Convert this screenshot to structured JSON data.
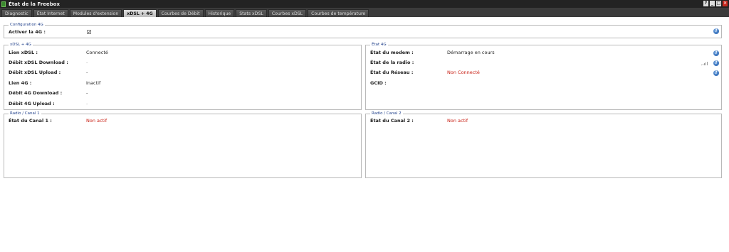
{
  "window": {
    "title": "État de la Freebox",
    "buttons": [
      "?",
      "_",
      "□",
      "✕"
    ]
  },
  "tabs": [
    {
      "label": "Diagnostic",
      "active": false
    },
    {
      "label": "État Internet",
      "active": false
    },
    {
      "label": "Modules d'extension",
      "active": false
    },
    {
      "label": "xDSL + 4G",
      "active": true
    },
    {
      "label": "Courbes de Débit",
      "active": false
    },
    {
      "label": "Historique",
      "active": false
    },
    {
      "label": "Stats xDSL",
      "active": false
    },
    {
      "label": "Courbes xDSL",
      "active": false
    },
    {
      "label": "Courbes de température",
      "active": false
    }
  ],
  "config4g": {
    "legend": "Configuration 4G",
    "activer_label": "Activer la 4G :",
    "activer_checked": true,
    "checkmark": "✓"
  },
  "xdsl4g": {
    "legend": "xDSL + 4G",
    "rows": [
      {
        "label": "Lien xDSL :",
        "value": "Connecté",
        "style": "normal"
      },
      {
        "label": "Débit xDSL Download :",
        "value": "-",
        "style": "muted"
      },
      {
        "label": "Débit xDSL Upload :",
        "value": "-",
        "style": "normal"
      },
      {
        "label": "Lien 4G :",
        "value": "Inactif",
        "style": "normal"
      },
      {
        "label": "Débit 4G Download :",
        "value": "-",
        "style": "normal"
      },
      {
        "label": "Débit 4G Upload :",
        "value": "-",
        "style": "muted"
      }
    ]
  },
  "etat4g": {
    "legend": "État 4G",
    "rows": [
      {
        "label": "État du modem :",
        "value": "Démarrage en cours",
        "style": "normal"
      },
      {
        "label": "État de la radio :",
        "value": "",
        "style": "normal"
      },
      {
        "label": "État du Réseau :",
        "value": "Non Connecté",
        "style": "red"
      },
      {
        "label": "GCID :",
        "value": "",
        "style": "normal"
      }
    ]
  },
  "radio1": {
    "legend": "Radio / Canal 1",
    "label": "État du Canal 1 :",
    "value": "Non actif"
  },
  "radio2": {
    "legend": "Radio / Canal 2",
    "label": "État du Canal 2 :",
    "value": "Non actif"
  },
  "help_glyph": "?",
  "colors": {
    "accent_red": "#c81d12",
    "legend_blue": "#1f3f8a",
    "help_blue": "#1e5aa8",
    "titlebar": "#232323"
  }
}
